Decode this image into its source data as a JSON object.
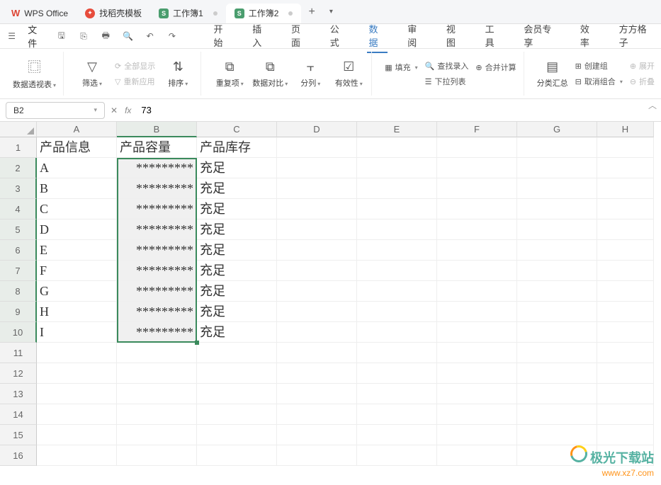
{
  "tabs": [
    {
      "label": "WPS Office",
      "type": "wps"
    },
    {
      "label": "找稻壳模板",
      "type": "fire"
    },
    {
      "label": "工作簿1",
      "type": "s",
      "modified": true
    },
    {
      "label": "工作簿2",
      "type": "s",
      "modified": true,
      "active": true
    }
  ],
  "filemenu": {
    "file": "文件",
    "menus": [
      "开始",
      "插入",
      "页面",
      "公式",
      "数据",
      "审阅",
      "视图",
      "工具",
      "会员专享",
      "效率",
      "方方格子"
    ],
    "active_index": 4
  },
  "ribbon": {
    "pivot": "数据透视表",
    "filter": "筛选",
    "showall": "全部显示",
    "reapply": "重新应用",
    "sort": "排序",
    "dup": "重复项",
    "compare": "数据对比",
    "split": "分列",
    "validity": "有效性",
    "fill": "填充",
    "find_input": "查找录入",
    "merge_calc": "合并计算",
    "dropdown": "下拉列表",
    "subtotal": "分类汇总",
    "group": "创建组",
    "ungroup": "取消组合",
    "expand": "展开",
    "collapse": "折叠"
  },
  "formulabar": {
    "cell_ref": "B2",
    "value": "73",
    "fx": "fx"
  },
  "grid": {
    "columns": [
      "A",
      "B",
      "C",
      "D",
      "E",
      "F",
      "G",
      "H"
    ],
    "selected_col_index": 1,
    "headers": [
      "产品信息",
      "产品容量",
      "产品库存"
    ],
    "rows": [
      {
        "a": "A",
        "b": "*********",
        "c": "充足"
      },
      {
        "a": "B",
        "b": "*********",
        "c": "充足"
      },
      {
        "a": "C",
        "b": "*********",
        "c": "充足"
      },
      {
        "a": "D",
        "b": "*********",
        "c": "充足"
      },
      {
        "a": "E",
        "b": "*********",
        "c": "充足"
      },
      {
        "a": "F",
        "b": "*********",
        "c": "充足"
      },
      {
        "a": "G",
        "b": "*********",
        "c": "充足"
      },
      {
        "a": "H",
        "b": "*********",
        "c": "充足"
      },
      {
        "a": "I",
        "b": "*********",
        "c": "充足"
      }
    ],
    "active_cell": "B2",
    "selection": {
      "col": "B",
      "row_start": 2,
      "row_end": 10
    }
  },
  "watermark": {
    "text1": "极光下载站",
    "text2": "www.xz7.com"
  }
}
